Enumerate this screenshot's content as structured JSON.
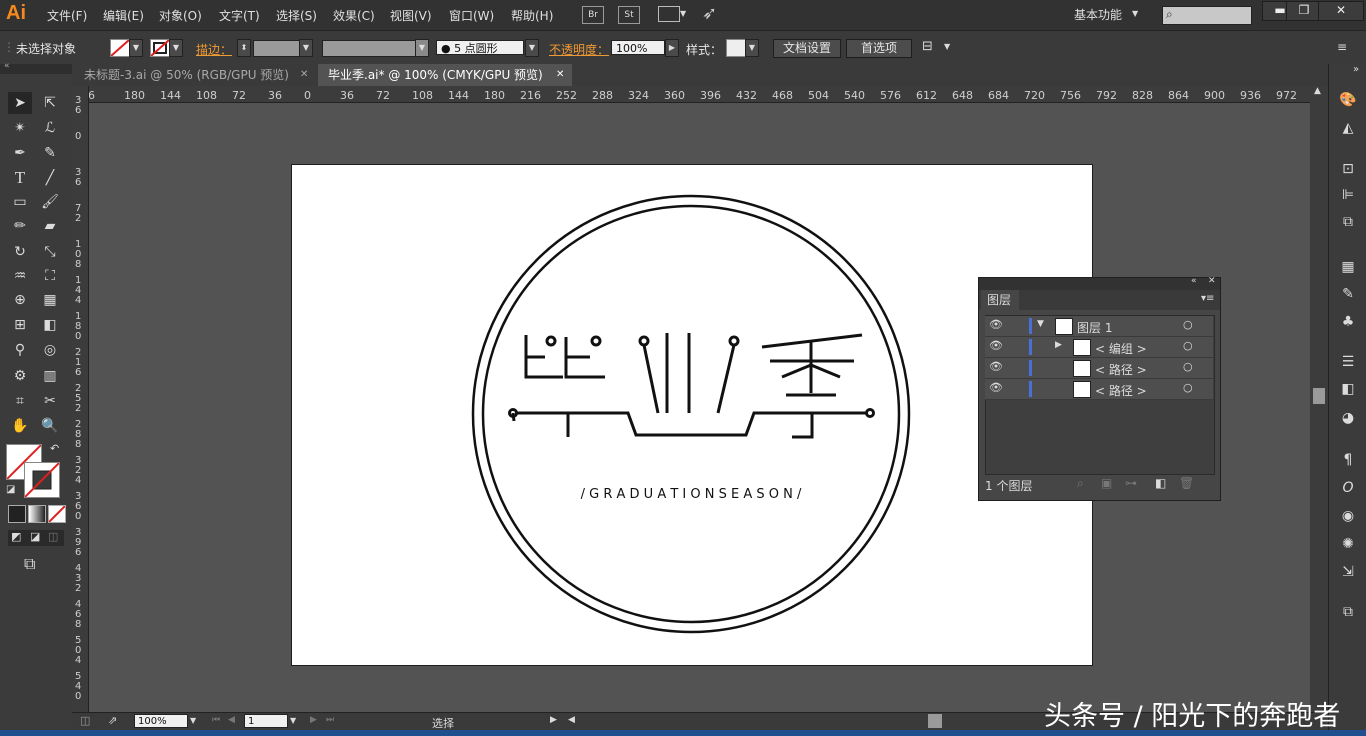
{
  "app": {
    "logo": "Ai",
    "accent": "#f5891e"
  },
  "menu": [
    "文件(F)",
    "编辑(E)",
    "对象(O)",
    "文字(T)",
    "选择(S)",
    "效果(C)",
    "视图(V)",
    "窗口(W)",
    "帮助(H)"
  ],
  "menubar_icons": {
    "bridge": "Br",
    "stock": "St"
  },
  "workspace": "基本功能",
  "window_buttons": {
    "minimize": "▬",
    "restore": "❐",
    "close": "✕"
  },
  "control": {
    "selection": "未选择对象",
    "stroke_label": "描边：",
    "brush": "5 点圆形",
    "opacity_label": "不透明度：",
    "opacity_value": "100%",
    "style_label": "样式：",
    "doc_setup": "文档设置",
    "preferences": "首选项"
  },
  "tabs": [
    {
      "label": "未标题-3.ai @ 50% (RGB/GPU 预览)",
      "close": "✕"
    },
    {
      "label": "毕业季.ai* @ 100% (CMYK/GPU 预览)",
      "close": "✕"
    }
  ],
  "hruler_ticks": [
    "6",
    "180",
    "144",
    "108",
    "72",
    "36",
    "0",
    "36",
    "72",
    "108",
    "144",
    "180",
    "216",
    "252",
    "288",
    "324",
    "360",
    "396",
    "432",
    "468",
    "504",
    "540",
    "576",
    "612",
    "648",
    "684",
    "720",
    "756",
    "792",
    "828",
    "864",
    "900",
    "936",
    "972",
    "10"
  ],
  "vruler_ticks": [
    "3\n6",
    "0",
    "3\n6",
    "7\n2",
    "1\n0\n8",
    "1\n4\n4",
    "1\n8\n0",
    "2\n1\n6",
    "2\n5\n2",
    "2\n8\n8",
    "3\n2\n4",
    "3\n6\n0",
    "3\n9\n6",
    "4\n3\n2",
    "4\n6\n8",
    "5\n0\n4",
    "5\n4\n0"
  ],
  "artwork": {
    "title_chars": "毕业季",
    "subtitle": "/ G R A D U A T I O N   S E A S O N /"
  },
  "layers_panel": {
    "title": "图层",
    "rows": [
      {
        "name": "图层 1",
        "expanded": true
      },
      {
        "name": "< 编组 >",
        "expanded": false
      },
      {
        "name": "< 路径 >"
      },
      {
        "name": "< 路径 >"
      }
    ],
    "footer": "1 个图层",
    "layer_color": "#4a6fd6"
  },
  "status": {
    "zoom": "100%",
    "page": "1",
    "mode": "选择"
  },
  "watermark": "头条号 / 阳光下的奔跑者"
}
